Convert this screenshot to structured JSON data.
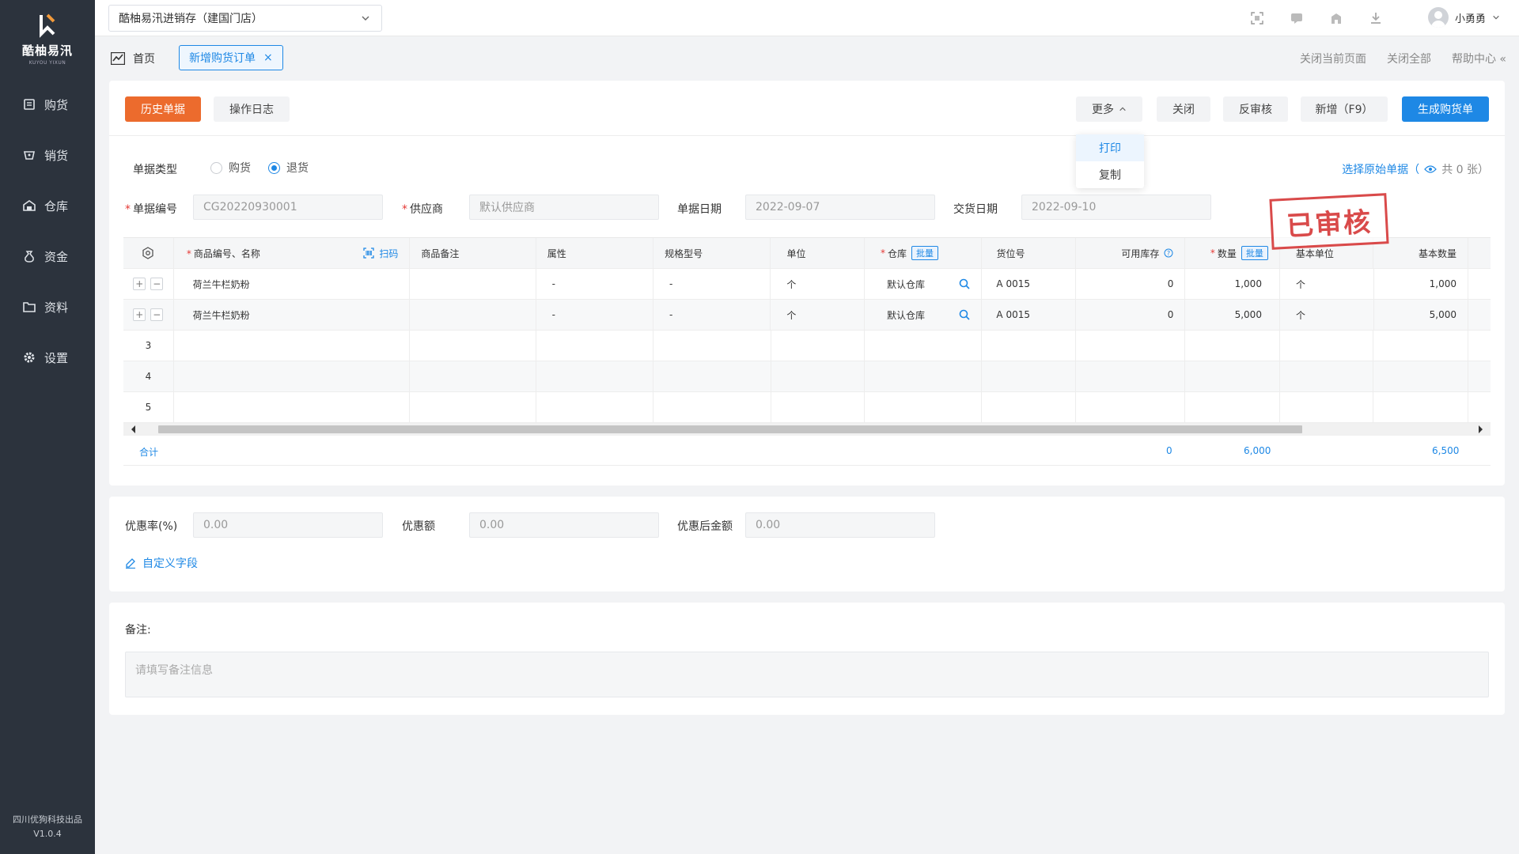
{
  "sidebar": {
    "logo_text": "酷柚易汛",
    "logo_sub": "KUYOU YIXUN",
    "items": [
      {
        "label": "购货",
        "icon": "purchase-icon"
      },
      {
        "label": "销货",
        "icon": "sales-icon"
      },
      {
        "label": "仓库",
        "icon": "warehouse-icon"
      },
      {
        "label": "资金",
        "icon": "funds-icon"
      },
      {
        "label": "资料",
        "icon": "data-icon"
      },
      {
        "label": "设置",
        "icon": "gear-icon"
      }
    ],
    "footer_company": "四川优狗科技出品",
    "footer_version": "V1.0.4"
  },
  "topbar": {
    "store": "酷柚易汛进销存（建国门店）",
    "user": "小勇勇"
  },
  "tabs": {
    "home": "首页",
    "active": "新增购货订单",
    "close_current": "关闭当前页面",
    "close_all": "关闭全部",
    "help": "帮助中心"
  },
  "toolbar": {
    "history": "历史单据",
    "oplog": "操作日志",
    "more": "更多",
    "close": "关闭",
    "unaudit": "反审核",
    "add": "新增（F9）",
    "generate": "生成购货单",
    "more_menu": [
      "打印",
      "复制"
    ]
  },
  "form": {
    "type_label": "单据类型",
    "type_options": [
      "购货",
      "退货"
    ],
    "type_selected": "退货",
    "source_link": "选择原始单据（",
    "source_count": "共 0 张）",
    "doc_no_label": "单据编号",
    "doc_no": "CG20220930001",
    "supplier_label": "供应商",
    "supplier_placeholder": "默认供应商",
    "doc_date_label": "单据日期",
    "doc_date": "2022-09-07",
    "delivery_date_label": "交货日期",
    "delivery_date": "2022-09-10",
    "stamp": "已审核"
  },
  "table": {
    "headers": {
      "product": "商品编号、名称",
      "scan": "扫码",
      "remark": "商品备注",
      "attr": "属性",
      "spec": "规格型号",
      "unit": "单位",
      "warehouse": "仓库",
      "batch": "批量",
      "location": "货位号",
      "stock": "可用库存",
      "qty": "数量",
      "base_unit": "基本单位",
      "base_qty": "基本数量"
    },
    "rows": [
      {
        "product": "荷兰牛栏奶粉",
        "remark": "",
        "attr": "-",
        "spec": "-",
        "unit": "个",
        "warehouse": "默认仓库",
        "location": "A  0015",
        "stock": "0",
        "qty": "1,000",
        "base_unit": "个",
        "base_qty": "1,000"
      },
      {
        "product": "荷兰牛栏奶粉",
        "remark": "",
        "attr": "-",
        "spec": "-",
        "unit": "个",
        "warehouse": "默认仓库",
        "location": "A  0015",
        "stock": "0",
        "qty": "5,000",
        "base_unit": "个",
        "base_qty": "5,000"
      }
    ],
    "empty_rows": [
      "3",
      "4",
      "5"
    ],
    "total_label": "合计",
    "total_stock": "0",
    "total_qty": "6,000",
    "total_base_qty": "6,500"
  },
  "discount": {
    "rate_label": "优惠率(%)",
    "rate": "0.00",
    "amount_label": "优惠额",
    "amount": "0.00",
    "after_label": "优惠后金额",
    "after": "0.00",
    "custom_field": "自定义字段"
  },
  "notes": {
    "label": "备注:",
    "placeholder": "请填写备注信息"
  },
  "colors": {
    "sidebar": "#2c333d",
    "accent_blue": "#1e88e5",
    "accent_orange": "#ec6b2d",
    "stamp_red": "#d94a4a"
  }
}
